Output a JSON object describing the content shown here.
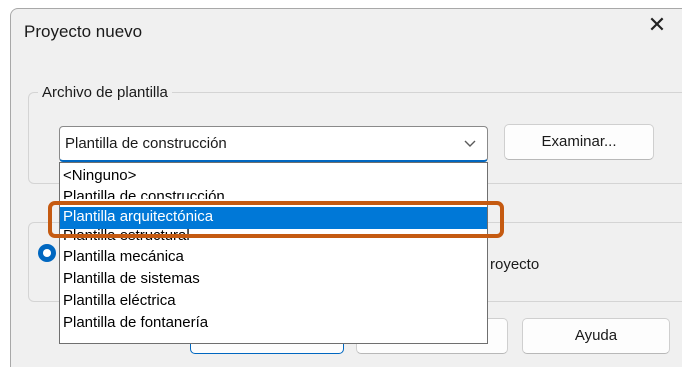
{
  "dialog": {
    "title": "Proyecto nuevo",
    "close_glyph": "✕"
  },
  "template": {
    "group_label": "Archivo de plantilla",
    "combo_value": "Plantilla de construcción",
    "browse_label": "Examinar...",
    "options": [
      "<Ninguno>",
      "Plantilla de construcción",
      "Plantilla arquitectónica",
      "Plantilla estructural",
      "Plantilla mecánica",
      "Plantilla de sistemas",
      "Plantilla eléctrica",
      "Plantilla de fontanería"
    ],
    "selected_option": "Plantilla arquitectónica"
  },
  "new_section": {
    "partial_text": "royecto"
  },
  "footer": {
    "help_label": "Ayuda"
  },
  "colors": {
    "accent": "#0067c0",
    "selection": "#0078d7",
    "annotation": "#c55a11"
  },
  "icons": {
    "close": "close-icon",
    "dropdown": "chevron-down-icon"
  }
}
